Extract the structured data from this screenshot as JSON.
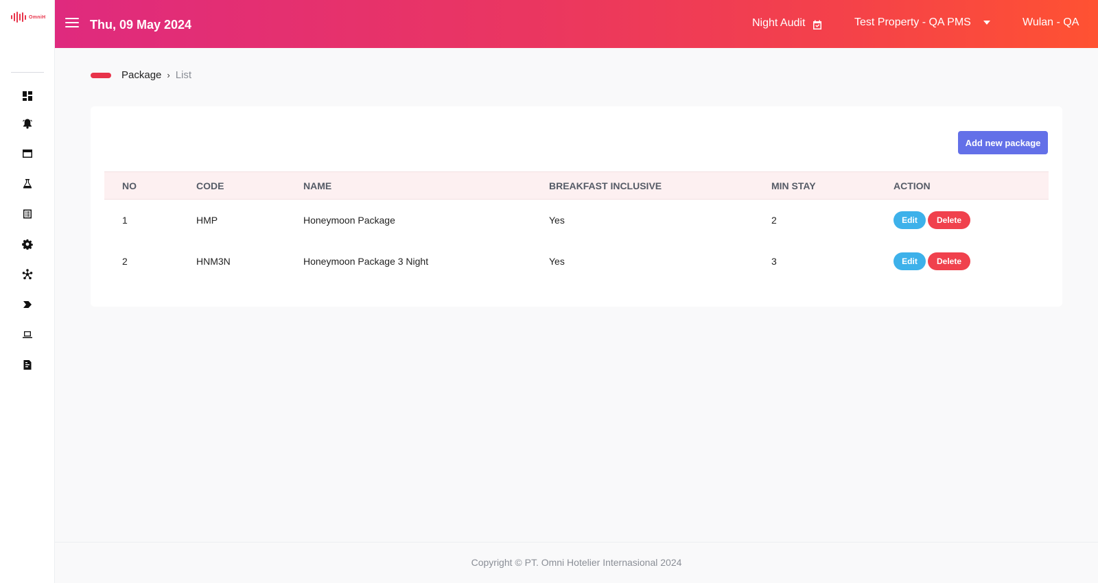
{
  "brand": {
    "name": "OmniH",
    "accent": "#e8334a"
  },
  "sidebar": {
    "icons": [
      "dashboard-icon",
      "alarm-bell-icon",
      "window-icon",
      "flask-icon",
      "list-document-icon",
      "gear-icon",
      "network-icon",
      "tag-icon",
      "laptop-icon",
      "report-document-icon"
    ]
  },
  "header": {
    "date": "Thu, 09 May 2024",
    "night_audit": "Night Audit",
    "property": "Test Property - QA PMS",
    "user": "Wulan - QA",
    "gradient": [
      "#df2a7e",
      "#ff5232"
    ]
  },
  "breadcrumb": {
    "current": "Package",
    "last": "List"
  },
  "actions": {
    "add_label": "Add new package",
    "add_color": "#6370e8"
  },
  "table": {
    "headers": [
      "NO",
      "CODE",
      "NAME",
      "BREAKFAST INCLUSIVE",
      "MIN STAY",
      "ACTION"
    ],
    "rows": [
      {
        "no": "1",
        "code": "HMP",
        "name": "Honeymoon Package",
        "breakfast": "Yes",
        "min_stay": "2",
        "edit": "Edit",
        "delete": "Delete"
      },
      {
        "no": "2",
        "code": "HNM3N",
        "name": "Honeymoon Package 3 Night",
        "breakfast": "Yes",
        "min_stay": "3",
        "edit": "Edit",
        "delete": "Delete"
      }
    ]
  },
  "footer": {
    "copyright": "Copyright © PT. Omni Hotelier Internasional 2024"
  }
}
